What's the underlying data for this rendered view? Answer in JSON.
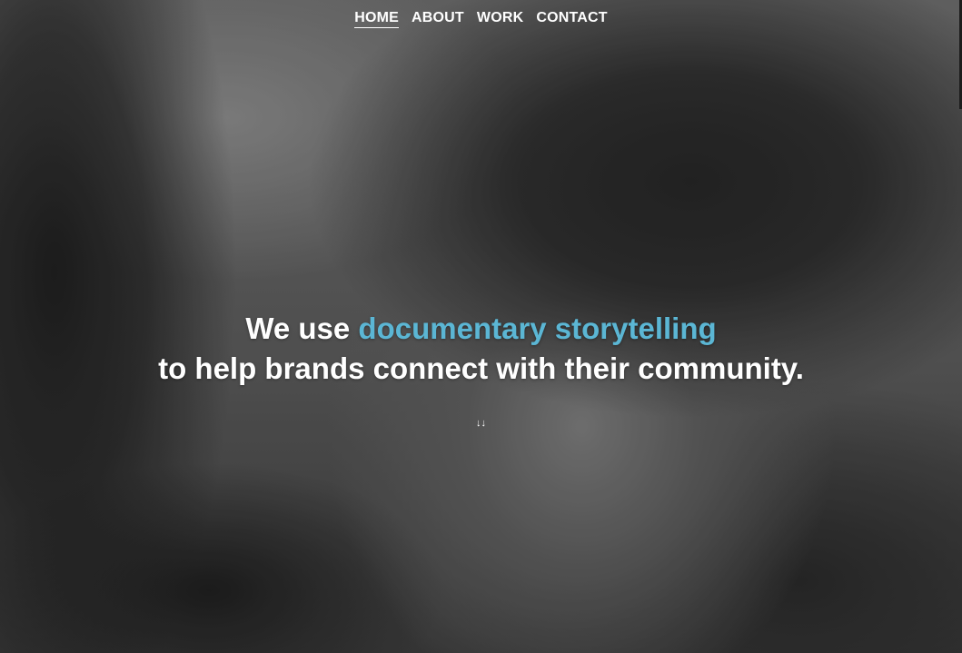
{
  "nav": {
    "items": [
      {
        "label": "HOME",
        "active": true
      },
      {
        "label": "ABOUT",
        "active": false
      },
      {
        "label": "WORK",
        "active": false
      },
      {
        "label": "CONTACT",
        "active": false
      }
    ]
  },
  "hero": {
    "line1_prefix": "We use ",
    "line1_accent": "documentary storytelling",
    "line2": "to help brands connect with their community.",
    "scroll_icon": "double-down-arrow-icon",
    "scroll_glyph": "↓↓"
  },
  "colors": {
    "accent": "#5bb6d4",
    "text": "#ffffff"
  }
}
